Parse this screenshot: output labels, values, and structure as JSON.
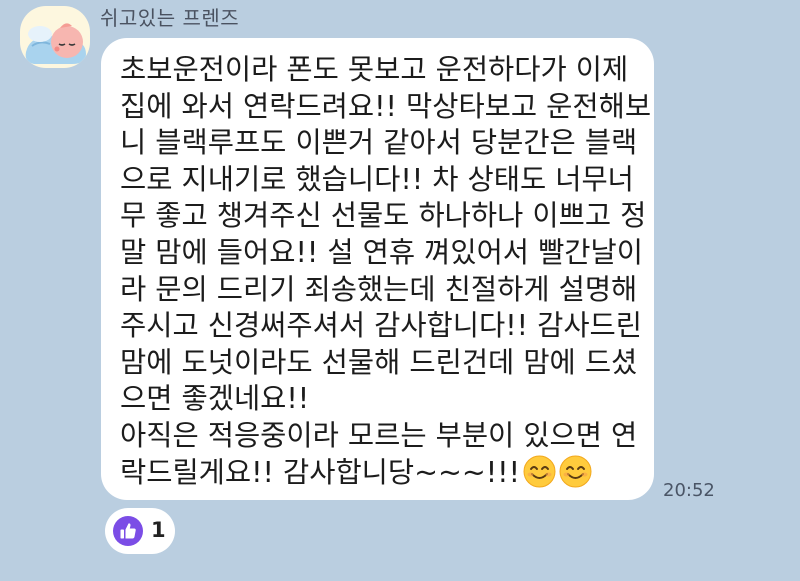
{
  "sender": {
    "name": "쉬고있는 프렌즈",
    "avatar_icon": "sleeping-apeach-avatar-icon"
  },
  "message": {
    "lines": [
      "초보운전이라 폰도 못보고 운전하다가 이제",
      "집에 와서 연락드려요!! 막상타보고 운전해보",
      "니 블랙루프도 이쁜거 같아서 당분간은 블랙",
      "으로 지내기로 했습니다!! 차 상태도 너무너",
      "무 좋고 챙겨주신 선물도 하나하나 이쁘고 정",
      "말 맘에 들어요!! 설 연휴 껴있어서 빨간날이",
      "라 문의 드리기 죄송했는데 친절하게 설명해",
      "주시고 신경써주셔서 감사합니다!! 감사드린",
      "맘에 도넛이라도 선물해 드린건데 맘에 드셨",
      "으면 좋겠네요!!",
      "아직은 적응중이라 모르는 부분이 있으면 연",
      "락드릴게요!! 감사합니당~~~!!!"
    ],
    "emojis": [
      "smiling-face-emoji",
      "smiling-face-emoji"
    ],
    "time": "20:52"
  },
  "reaction": {
    "icon": "thumbs-up-icon",
    "count": "1",
    "color": "#7b4de6"
  },
  "colors": {
    "background": "#bacee0",
    "bubble": "#ffffff"
  }
}
